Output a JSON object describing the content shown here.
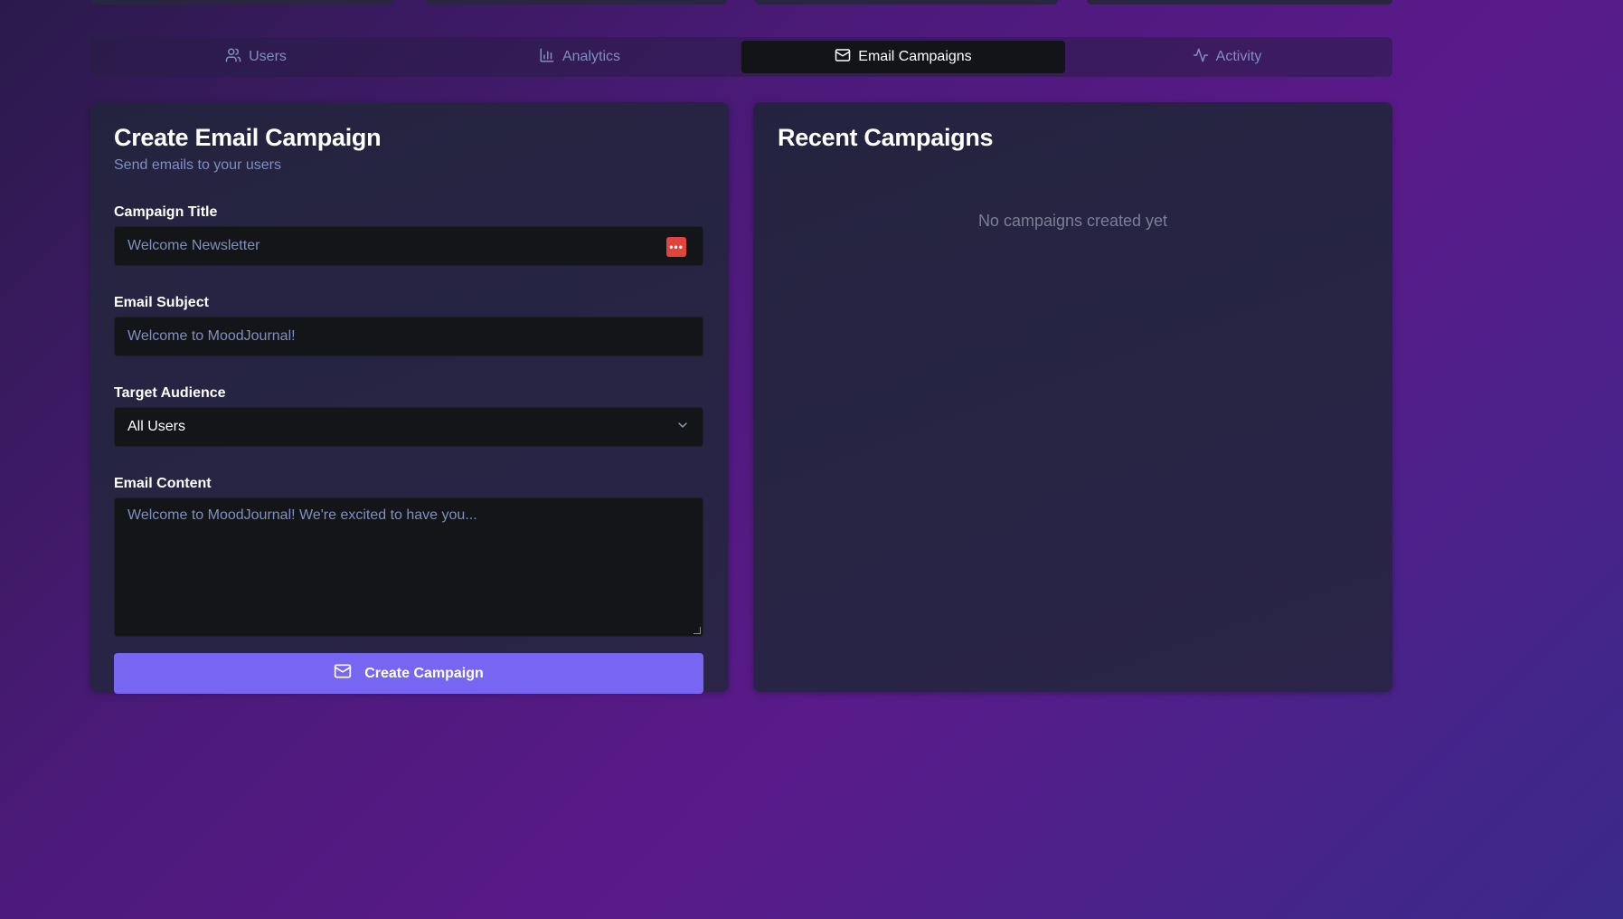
{
  "tabs": [
    {
      "label": "Users",
      "icon": "users-icon",
      "active": false
    },
    {
      "label": "Analytics",
      "icon": "bar-chart-icon",
      "active": false
    },
    {
      "label": "Email Campaigns",
      "icon": "mail-icon",
      "active": true
    },
    {
      "label": "Activity",
      "icon": "activity-icon",
      "active": false
    }
  ],
  "create_form": {
    "title": "Create Email Campaign",
    "subtitle": "Send emails to your users",
    "campaign_title": {
      "label": "Campaign Title",
      "placeholder": "Welcome Newsletter",
      "value": ""
    },
    "email_subject": {
      "label": "Email Subject",
      "placeholder": "Welcome to MoodJournal!",
      "value": ""
    },
    "target_audience": {
      "label": "Target Audience",
      "selected": "All Users"
    },
    "email_content": {
      "label": "Email Content",
      "placeholder": "Welcome to MoodJournal! We're excited to have you..."
    },
    "submit_label": "Create Campaign"
  },
  "recent": {
    "title": "Recent Campaigns",
    "empty_text": "No campaigns created yet"
  },
  "colors": {
    "accent": "#7866f2",
    "muted_text": "#7f8fc0",
    "password_manager_icon": "#e0443c"
  }
}
